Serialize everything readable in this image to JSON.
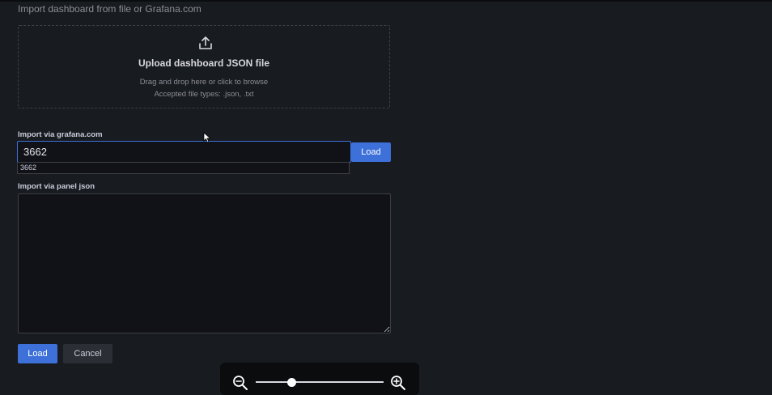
{
  "header": {
    "subtitle": "Import dashboard from file or Grafana.com"
  },
  "dropzone": {
    "icon": "upload-icon",
    "title": "Upload dashboard JSON file",
    "hint": "Drag and drop here or click to browse",
    "accepted": "Accepted file types: .json, .txt"
  },
  "grafana_import": {
    "label": "Import via grafana.com",
    "value": "3662",
    "suggestion": "3662",
    "load_label": "Load"
  },
  "panel_json": {
    "label": "Import via panel json",
    "value": ""
  },
  "actions": {
    "load_label": "Load",
    "cancel_label": "Cancel"
  },
  "zoom": {
    "level": 0.28,
    "icons": [
      "zoom-out-icon",
      "zoom-in-icon"
    ]
  },
  "colors": {
    "accent": "#3d71d9",
    "background": "#181b1f",
    "input_bg": "#111217"
  }
}
